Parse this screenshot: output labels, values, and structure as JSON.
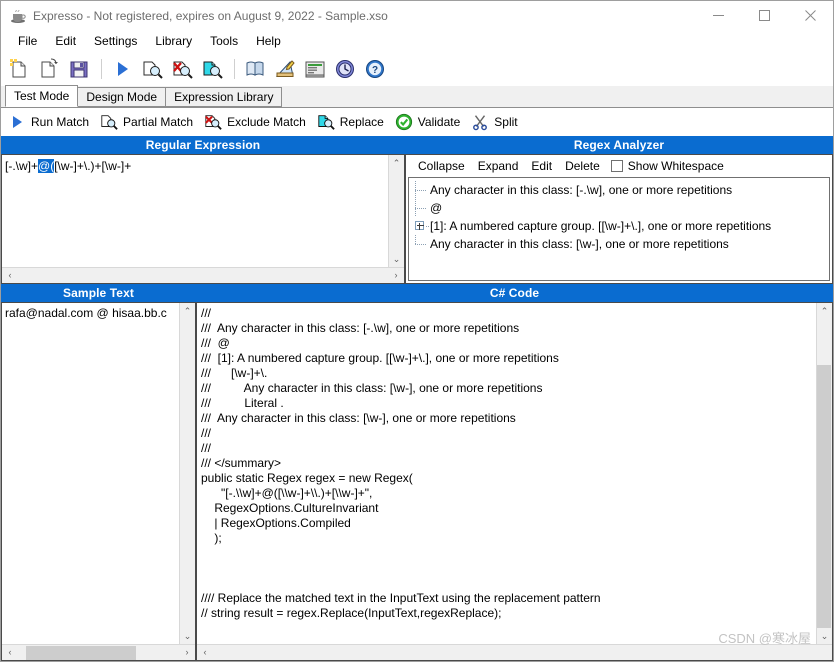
{
  "window": {
    "title": "Expresso - Not registered, expires on August 9, 2022 - Sample.xso",
    "icon": "app-coffee-icon",
    "minimize": "–",
    "maximize": "□",
    "close": "✕"
  },
  "menu": {
    "items": [
      {
        "label": "File"
      },
      {
        "label": "Edit"
      },
      {
        "label": "Settings"
      },
      {
        "label": "Library"
      },
      {
        "label": "Tools"
      },
      {
        "label": "Help"
      }
    ]
  },
  "toolbar": {
    "buttons": [
      {
        "name": "new-document-icon",
        "title": "New"
      },
      {
        "name": "open-document-icon",
        "title": "Open"
      },
      {
        "name": "save-icon",
        "title": "Save"
      },
      {
        "name": "run-match-icon",
        "title": "Run Match"
      },
      {
        "name": "partial-match-icon",
        "title": "Partial Match"
      },
      {
        "name": "exclude-match-icon",
        "title": "Exclude Match"
      },
      {
        "name": "replace-icon",
        "title": "Replace"
      },
      {
        "name": "library-icon",
        "title": "Library"
      },
      {
        "name": "design-icon",
        "title": "Design"
      },
      {
        "name": "report-icon",
        "title": "Report"
      },
      {
        "name": "history-icon",
        "title": "History"
      },
      {
        "name": "help-icon",
        "title": "Help"
      }
    ]
  },
  "tabs": {
    "items": [
      {
        "label": "Test Mode",
        "active": true
      },
      {
        "label": "Design Mode",
        "active": false
      },
      {
        "label": "Expression Library",
        "active": false
      }
    ]
  },
  "actions": {
    "items": [
      {
        "label": "Run Match",
        "icon": "play-triangle-icon"
      },
      {
        "label": "Partial Match",
        "icon": "partial-match-icon"
      },
      {
        "label": "Exclude Match",
        "icon": "exclude-match-icon"
      },
      {
        "label": "Replace",
        "icon": "replace-icon"
      },
      {
        "label": "Validate",
        "icon": "validate-check-icon"
      },
      {
        "label": "Split",
        "icon": "scissors-icon"
      }
    ]
  },
  "regex_panel": {
    "title": "Regular Expression",
    "before": "[-.\\w]+",
    "selected": "@(",
    "after": "[\\w-]+\\.)+[\\w-]+"
  },
  "analyzer_panel": {
    "title": "Regex Analyzer",
    "toolbar": {
      "collapse": "Collapse",
      "expand": "Expand",
      "edit": "Edit",
      "delete": "Delete",
      "show_whitespace": "Show Whitespace",
      "show_whitespace_checked": false
    },
    "tree": [
      {
        "text": "Any character in this class: [-.\\w], one or more repetitions",
        "expander": false,
        "last": false
      },
      {
        "text": "@",
        "expander": false,
        "last": false
      },
      {
        "text": "[1]: A numbered capture group. [[\\w-]+\\.], one or more repetitions",
        "expander": true,
        "last": false
      },
      {
        "text": "Any character in this class: [\\w-], one or more repetitions",
        "expander": false,
        "last": true
      }
    ]
  },
  "sample_panel": {
    "title": "Sample Text",
    "text": "rafa@nadal.com @ hisaa.bb.c"
  },
  "code_panel": {
    "title": "C# Code",
    "lines": [
      "///",
      "///  Any character in this class: [-.\\w], one or more repetitions",
      "///  @",
      "///  [1]: A numbered capture group. [[\\w-]+\\.], one or more repetitions",
      "///      [\\w-]+\\.",
      "///          Any character in this class: [\\w-], one or more repetitions",
      "///          Literal .",
      "///  Any character in this class: [\\w-], one or more repetitions",
      "///",
      "///",
      "/// </summary>",
      "public static Regex regex = new Regex(",
      "      \"[-.\\\\w]+@([\\\\w-]+\\\\.)+[\\\\w-]+\",",
      "    RegexOptions.CultureInvariant",
      "    | RegexOptions.Compiled",
      "    );",
      "",
      "",
      "",
      "//// Replace the matched text in the InputText using the replacement pattern",
      "// string result = regex.Replace(InputText,regexReplace);"
    ]
  },
  "scroll": {
    "up": "⌃",
    "down": "⌄",
    "left": "‹",
    "right": "›"
  },
  "watermark": "CSDN @寒冰屋",
  "colors": {
    "panel_header": "#0a6cd0",
    "selection": "#0a6cd0",
    "window_bg": "#ffffff"
  }
}
